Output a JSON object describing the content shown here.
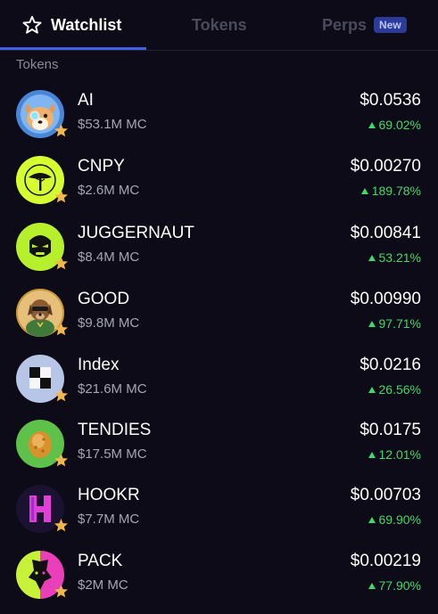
{
  "tabs": {
    "watchlist": "Watchlist",
    "tokens": "Tokens",
    "perps": "Perps",
    "perps_badge": "New"
  },
  "section_label": "Tokens",
  "colors": {
    "background": "#0c0b17",
    "accent": "#3f5fe8",
    "positive": "#3ed96a",
    "star": "#f2b74a"
  },
  "tokens": [
    {
      "name": "AI",
      "market_cap": "$53.1M MC",
      "price": "$0.0536",
      "change": "69.02%",
      "icon": "shiba-cyborg-icon"
    },
    {
      "name": "CNPY",
      "market_cap": "$2.6M MC",
      "price": "$0.00270",
      "change": "189.78%",
      "icon": "canopy-tree-icon"
    },
    {
      "name": "JUGGERNAUT",
      "market_cap": "$8.4M MC",
      "price": "$0.00841",
      "change": "53.21%",
      "icon": "juggernaut-face-icon"
    },
    {
      "name": "GOOD",
      "market_cap": "$9.8M MC",
      "price": "$0.00990",
      "change": "97.71%",
      "icon": "dog-character-icon"
    },
    {
      "name": "Index",
      "market_cap": "$21.6M MC",
      "price": "$0.0216",
      "change": "26.56%",
      "icon": "checker-blocks-icon"
    },
    {
      "name": "TENDIES",
      "market_cap": "$17.5M MC",
      "price": "$0.0175",
      "change": "12.01%",
      "icon": "chicken-tender-icon"
    },
    {
      "name": "HOOKR",
      "market_cap": "$7.7M MC",
      "price": "$0.00703",
      "change": "69.90%",
      "icon": "hook-letter-h-icon"
    },
    {
      "name": "PACK",
      "market_cap": "$2M MC",
      "price": "$0.00219",
      "change": "77.90%",
      "icon": "wolf-pack-icon"
    }
  ]
}
